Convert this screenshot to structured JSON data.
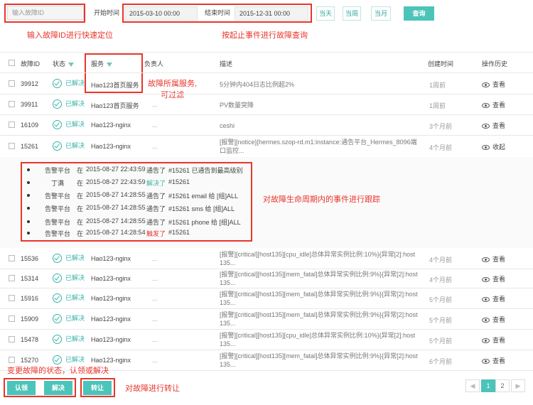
{
  "toolbar": {
    "fault_id_placeholder": "输入故障ID",
    "start_label": "开始时间",
    "start_value": "2015-03-10 00:00",
    "end_label": "结束时间",
    "end_value": "2015-12-31 00:00",
    "today": "当天",
    "this_week": "当周",
    "this_month": "当月",
    "search": "查询"
  },
  "annotations": {
    "a1": "输入故障ID进行快速定位",
    "a2": "按起止事件进行故障查询",
    "a3_line1": "故障所属服务,",
    "a3_line2": "可过滤",
    "a4": "对故障生命周期内的事件进行跟踪",
    "a5": "变更故障的状态，认领或解决",
    "a6": "对故障进行转让"
  },
  "table": {
    "headers": {
      "id": "故障ID",
      "status": "状态",
      "service": "服务",
      "owner": "负责人",
      "desc": "描述",
      "created": "创建时间",
      "history": "操作历史"
    },
    "rows": [
      {
        "id": "39912",
        "status": "已解决",
        "service": "Hao123首页服务",
        "owner": "",
        "desc": "5分钟内404日志比例超2%",
        "created": "1周前",
        "action": "查看"
      },
      {
        "id": "39911",
        "status": "已解决",
        "service": "Hao123首页服务",
        "owner": "...",
        "desc": "PV数量突降",
        "created": "1周前",
        "action": "查看"
      },
      {
        "id": "16109",
        "status": "已解决",
        "service": "Hao123-nginx",
        "owner": "...",
        "desc": "ceshi",
        "created": "3个月前",
        "action": "查看"
      },
      {
        "id": "15261",
        "status": "已解决",
        "service": "Hao123-nginx",
        "owner": "...",
        "desc": "[报警][notice]{hermes.szop-rd.m1:instance:通告平台_Hermes_8096端口监控...",
        "created": "4个月前",
        "action": "收起"
      },
      {
        "id": "15536",
        "status": "已解决",
        "service": "Hao123-nginx",
        "owner": "...",
        "desc": "[报警][critical][host135][cpu_idle]总体异常实例比例:10%}{异常[2]:host135...",
        "created": "4个月前",
        "action": "查看"
      },
      {
        "id": "15314",
        "status": "已解决",
        "service": "Hao123-nginx",
        "owner": "...",
        "desc": "[报警][critical][host135][mem_fatal]总体异常实例比例:9%}{异常[2]:host135...",
        "created": "4个月前",
        "action": "查看"
      },
      {
        "id": "15916",
        "status": "已解决",
        "service": "Hao123-nginx",
        "owner": "...",
        "desc": "[报警][critical][host135][mem_fatal]总体异常实例比例:9%}{异常[2]:host135...",
        "created": "5个月前",
        "action": "查看"
      },
      {
        "id": "15909",
        "status": "已解决",
        "service": "Hao123-nginx",
        "owner": "...",
        "desc": "[报警][critical][host135][mem_fatal]总体异常实例比例:9%}{异常[2]:host135...",
        "created": "5个月前",
        "action": "查看"
      },
      {
        "id": "15478",
        "status": "已解决",
        "service": "Hao123-nginx",
        "owner": "...",
        "desc": "[报警][critical][host135][cpu_idle]总体异常实例比例:10%}{异常[2]:host135...",
        "created": "5个月前",
        "action": "查看"
      },
      {
        "id": "15270",
        "status": "已解决",
        "service": "Hao123-nginx",
        "owner": "...",
        "desc": "[报警][critical][host135][mem_fatal]总体异常实例比例:9%}{异常[2]:host135...",
        "created": "6个月前",
        "action": "查看"
      }
    ]
  },
  "timeline": [
    {
      "who": "告警平台",
      "at": "在",
      "time": "2015-08-27 22:43:59",
      "verb": "通告了",
      "text": "#15261 已通告到最高级别"
    },
    {
      "who": "丁满",
      "at": "在",
      "time": "2015-08-27 22:43:59",
      "verb": "解决了",
      "text": "#15261"
    },
    {
      "who": "告警平台",
      "at": "在",
      "time": "2015-08-27 14:28:55",
      "verb": "通告了",
      "text": "#15261 email 给 [组]ALL"
    },
    {
      "who": "告警平台",
      "at": "在",
      "time": "2015-08-27 14:28:55",
      "verb": "通告了",
      "text": "#15261 sms 给 [组]ALL"
    },
    {
      "who": "告警平台",
      "at": "在",
      "time": "2015-08-27 14:28:55",
      "verb": "通告了",
      "text": "#15261 phone 给 [组]ALL"
    },
    {
      "who": "告警平台",
      "at": "在",
      "time": "2015-08-27 14:28:54",
      "verb": "触发了",
      "text": "#15261"
    }
  ],
  "footer": {
    "claim": "认领",
    "resolve": "解决",
    "transfer": "转让",
    "pages": [
      "1",
      "2"
    ]
  },
  "colors": {
    "accent": "#4cc4b9",
    "annotation": "#e8352b",
    "resolved_verb": "#36b3a8",
    "triggered_verb": "#e8352b"
  }
}
